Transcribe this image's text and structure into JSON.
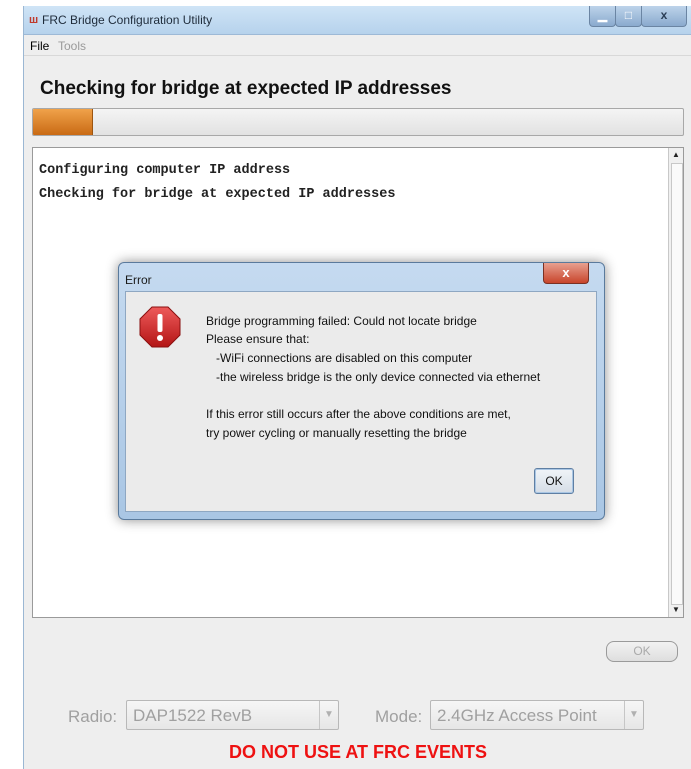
{
  "window": {
    "title": "FRC Bridge Configuration Utility",
    "app_icon": "frc-logo-icon",
    "controls": {
      "minimize": "▁",
      "maximize": "□",
      "close": "x"
    }
  },
  "menu": {
    "file": "File",
    "tools": "Tools"
  },
  "main": {
    "heading": "Checking for bridge at expected IP addresses",
    "progress_fraction": 0.09,
    "log_lines": [
      "Configuring computer IP address",
      "Checking for bridge at expected IP addresses"
    ],
    "ok_label": "OK"
  },
  "bottom": {
    "radio_label": "Radio:",
    "radio_value": "DAP1522 RevB",
    "mode_label": "Mode:",
    "mode_value": "2.4GHz Access Point",
    "warning": "DO NOT USE AT FRC EVENTS"
  },
  "dialog": {
    "title": "Error",
    "close": "x",
    "icon": "error-icon",
    "lines": [
      "Bridge programming failed: Could not locate bridge",
      "Please ensure that:",
      "   -WiFi connections are disabled on this computer",
      "   -the wireless bridge is the only device connected via ethernet",
      "If this error still occurs after the above conditions are met,",
      "try power cycling or manually resetting the bridge"
    ],
    "ok_label": "OK"
  },
  "colors": {
    "progress": "#e07f22",
    "warning": "#ee1111",
    "titlebar": "#b6d2ec"
  }
}
